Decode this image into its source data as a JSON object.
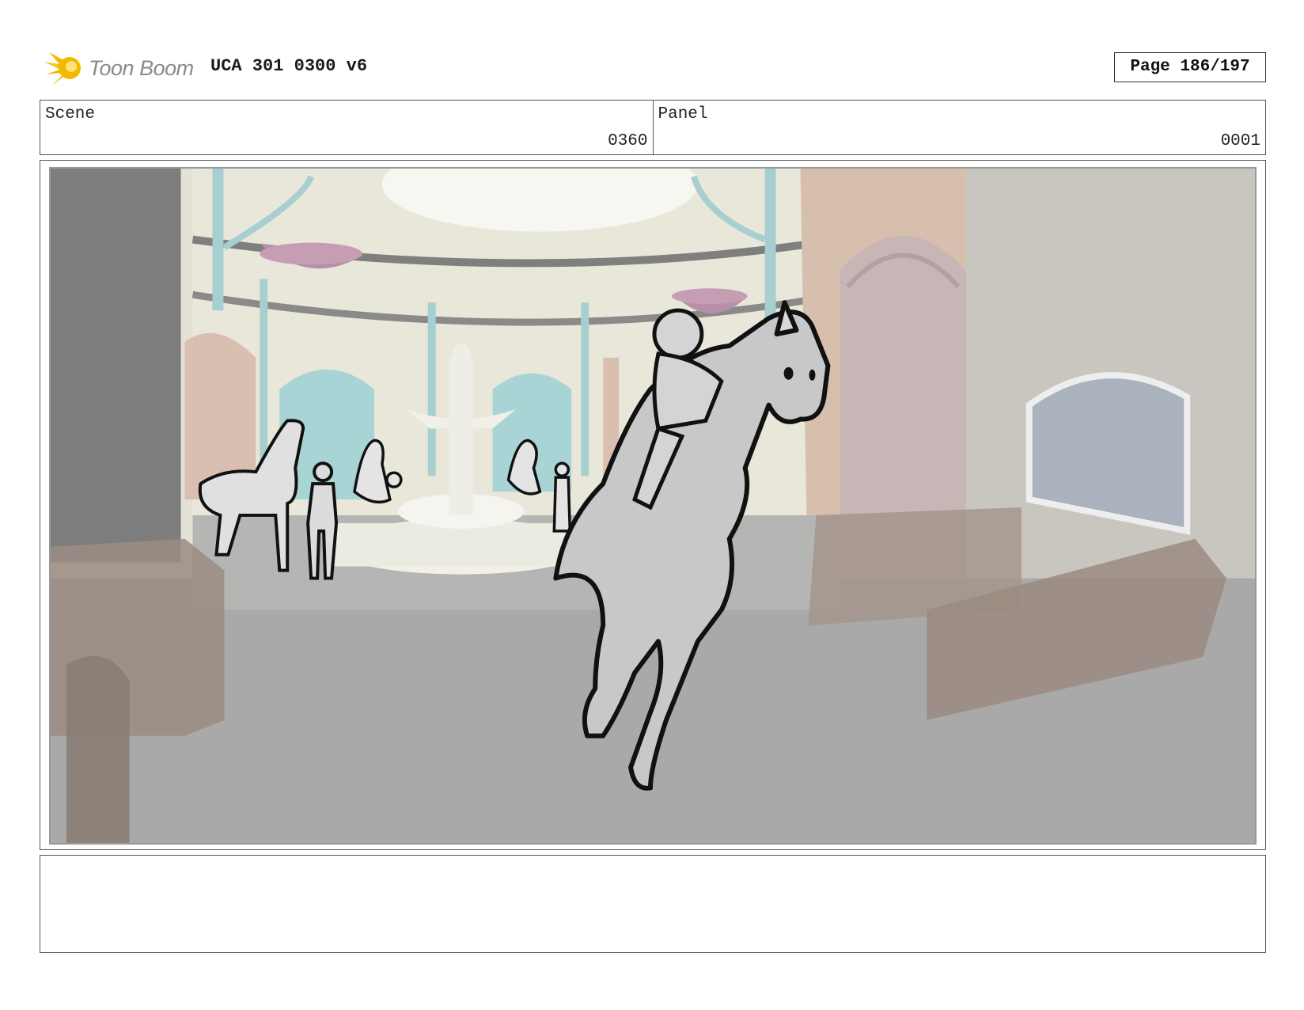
{
  "header": {
    "logo_text": "Toon Boom",
    "document_title": "UCA 301 0300 v6",
    "page_indicator": "Page 186/197"
  },
  "scene": {
    "label": "Scene",
    "value": "0360"
  },
  "panel": {
    "label": "Panel",
    "value": "0001"
  },
  "notes": {
    "text": ""
  },
  "colors": {
    "logo_yellow": "#f5b800",
    "floor": "#a9a9a9",
    "wall_cream": "#e6e3d6",
    "accent_teal": "#a7cfcf",
    "basket_pink": "#b790a8",
    "sketch_gray": "#c8c8c8"
  }
}
